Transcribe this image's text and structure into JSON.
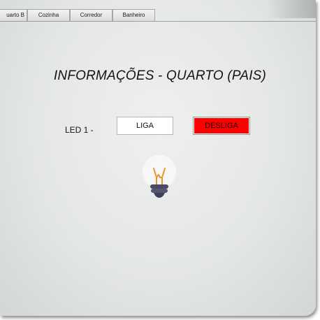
{
  "tabs": [
    {
      "label": "uarto B"
    },
    {
      "label": "Cozinha"
    },
    {
      "label": "Corredor"
    },
    {
      "label": "Banheiro"
    }
  ],
  "page": {
    "title": "INFORMAÇÕES - QUARTO (PAIS)"
  },
  "led": {
    "label": "LED 1 -",
    "on_label": "LIGA",
    "off_label": "DESLIGA",
    "off_color": "#ff0000",
    "icon": "lightbulb-icon"
  }
}
